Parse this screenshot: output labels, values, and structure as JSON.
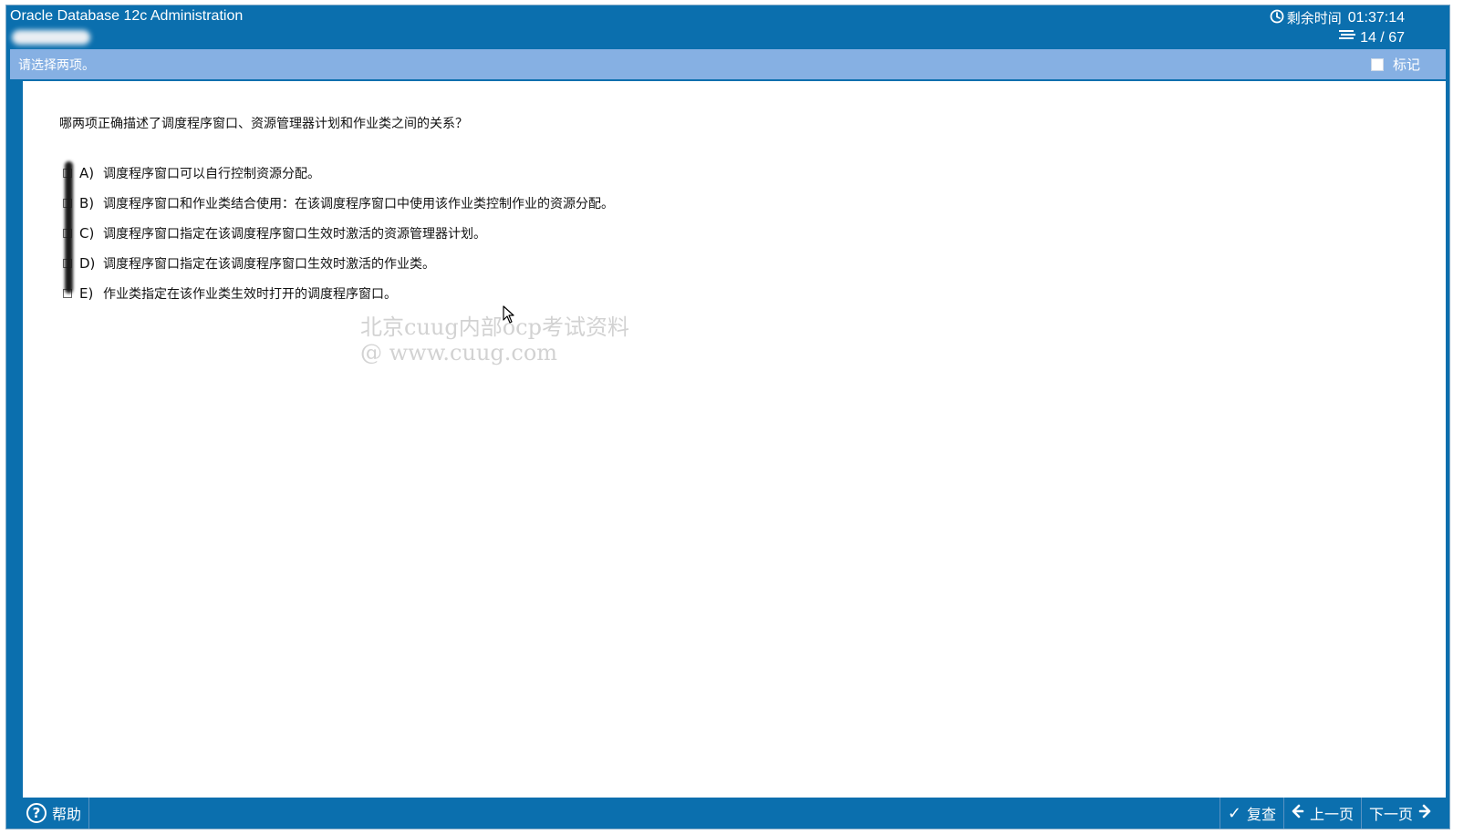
{
  "window": {
    "title": "Oracle Database 12c Administration",
    "timer_label": "剩余时间",
    "timer_value": "01:37:14",
    "question_counter": "14 / 67"
  },
  "instruction": {
    "text": "请选择两项。",
    "mark_label": "标记"
  },
  "question": {
    "text": "哪两项正确描述了调度程序窗口、资源管理器计划和作业类之间的关系？",
    "options": [
      {
        "letter": "A)",
        "text": "调度程序窗口可以自行控制资源分配。"
      },
      {
        "letter": "B)",
        "text": "调度程序窗口和作业类结合使用：在该调度程序窗口中使用该作业类控制作业的资源分配。"
      },
      {
        "letter": "C)",
        "text": "调度程序窗口指定在该调度程序窗口生效时激活的资源管理器计划。"
      },
      {
        "letter": "D)",
        "text": "调度程序窗口指定在该调度程序窗口生效时激活的作业类。"
      },
      {
        "letter": "E)",
        "text": "作业类指定在该作业类生效时打开的调度程序窗口。"
      }
    ]
  },
  "watermark": {
    "line1": "北京cuug内部ocp考试资料",
    "line2": "@ www.cuug.com"
  },
  "footer": {
    "help_label": "帮助",
    "review_label": "复查",
    "prev_label": "上一页",
    "next_label": "下一页"
  },
  "icons": {
    "timer": "clock-icon",
    "counter": "list-icon",
    "help": "question-circle-icon",
    "review": "check-icon",
    "prev": "arrow-left-icon",
    "next": "arrow-right-icon"
  },
  "colors": {
    "header_blue": "#0b6fae",
    "instruction_bar": "#86b0e3",
    "content_bg": "#ffffff",
    "watermark": "#d2d2d2"
  }
}
